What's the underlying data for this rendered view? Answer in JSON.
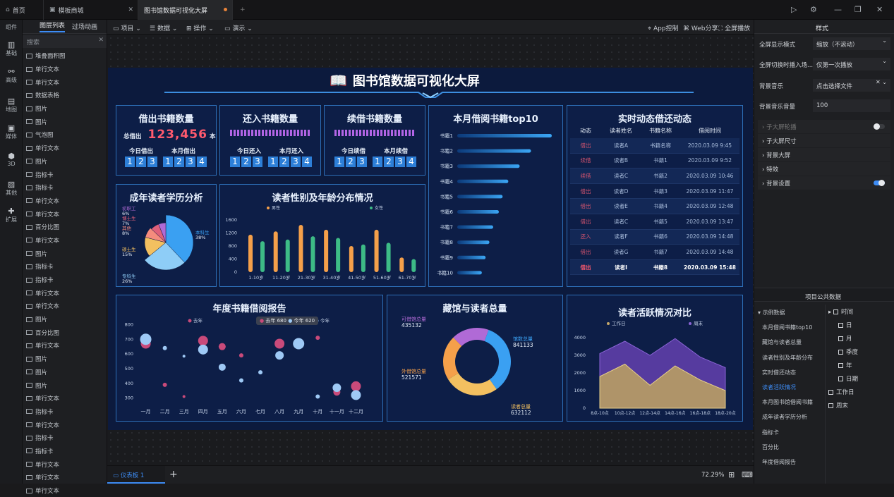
{
  "tabs": [
    {
      "label": "首页",
      "icon": "home-icon"
    },
    {
      "label": "模板商城",
      "icon": "store-icon"
    },
    {
      "label": "图书馆数据可视化大屏",
      "icon": ""
    }
  ],
  "left_nav": [
    {
      "label": "组件"
    },
    {
      "label": "基础"
    },
    {
      "label": "高级"
    },
    {
      "label": "地图"
    },
    {
      "label": "媒体"
    },
    {
      "label": "3D"
    },
    {
      "label": "其他"
    },
    {
      "label": "扩展"
    }
  ],
  "layers": {
    "tab_active": "图层列表",
    "tab_other": "过场动画",
    "search_placeholder": "搜索",
    "items": [
      "堆叠面积图",
      "单行文本",
      "单行文本",
      "数据表格",
      "图片",
      "图片",
      "气泡图",
      "单行文本",
      "图片",
      "指标卡",
      "指标卡",
      "单行文本",
      "单行文本",
      "百分比图",
      "单行文本",
      "图片",
      "指标卡",
      "指标卡",
      "单行文本",
      "单行文本",
      "图片",
      "百分比图",
      "单行文本",
      "图片",
      "图片",
      "图片",
      "单行文本",
      "指标卡",
      "单行文本",
      "指标卡",
      "指标卡",
      "单行文本",
      "单行文本",
      "单行文本"
    ]
  },
  "toolbar": {
    "project": "项目",
    "data": "数据",
    "operate": "操作",
    "demo": "演示",
    "app": "App控制",
    "web": "Web分享",
    "fullscreen": "全屏播放"
  },
  "status": {
    "board_tab": "仪表板 1",
    "add": "+",
    "zoom": "72.29%"
  },
  "right_panel": {
    "tab": "样式",
    "rows": [
      {
        "label": "全屏显示模式",
        "value": "缩放（不滚动）"
      },
      {
        "label": "全屏切换时播入场...",
        "value": "仅第一次播放"
      },
      {
        "label": "背景音乐",
        "value": "点击选择文件"
      },
      {
        "label": "背景音乐音量",
        "value": "100"
      }
    ],
    "sections": [
      "子大屏轮播",
      "子大屏尺寸",
      "背景大屏",
      "特效",
      "背景设置"
    ],
    "public_data_title": "项目公共数据",
    "public_data_list": [
      "示例数据",
      "本月借阅书籍top10",
      "藏馆与读者总量",
      "读者性别及年龄分布",
      "实时借还动态",
      "读者活跃情况",
      "本月图书馆借阅书籍",
      "成年读者学历分析",
      "指标卡",
      "百分比",
      "年度借阅报告"
    ],
    "fields": [
      "时间",
      "日",
      "月",
      "季度",
      "年",
      "日期",
      "工作日",
      "周末"
    ]
  },
  "dashboard": {
    "title": "图书馆数据可视化大屏",
    "borrow": {
      "title": "借出书籍数量",
      "total_label": "总借出",
      "total": "123,456",
      "unit": "本",
      "today_label": "今日借出",
      "today": [
        "1",
        "2",
        "3"
      ],
      "month_label": "本月借出",
      "month": [
        "1",
        "2",
        "3",
        "4"
      ]
    },
    "return": {
      "title": "还入书籍数量",
      "today_label": "今日还入",
      "today": [
        "1",
        "2",
        "3"
      ],
      "month_label": "本月还入",
      "month": [
        "1",
        "2",
        "3",
        "4"
      ]
    },
    "renew": {
      "title": "续借书籍数量",
      "today_label": "今日续借",
      "today": [
        "1",
        "2",
        "3"
      ],
      "month_label": "本月续借",
      "month": [
        "1",
        "2",
        "3",
        "4"
      ]
    },
    "top10": {
      "title": "本月借阅书籍top10"
    },
    "live": {
      "title": "实时动态借还动态",
      "headers": [
        "动态",
        "读者姓名",
        "书籍名称",
        "借阅时间"
      ],
      "rows": [
        [
          "借出",
          "读者A",
          "书籍名称",
          "2020.03.09 9:45"
        ],
        [
          "续借",
          "读者B",
          "书籍1",
          "2020.03.09 9:52"
        ],
        [
          "续借",
          "读者C",
          "书籍2",
          "2020.03.09 10:46"
        ],
        [
          "借出",
          "读者D",
          "书籍3",
          "2020.03.09 11:47"
        ],
        [
          "借出",
          "读者E",
          "书籍4",
          "2020.03.09 12:48"
        ],
        [
          "借出",
          "读者C",
          "书籍5",
          "2020.03.09 13:47"
        ],
        [
          "还入",
          "读者F",
          "书籍6",
          "2020.03.09 14:48"
        ],
        [
          "借出",
          "读者G",
          "书籍7",
          "2020.03.09 14:48"
        ],
        [
          "借出",
          "读者I",
          "书籍8",
          "2020.03.09 15:48"
        ]
      ]
    },
    "edu": {
      "title": "成年读者学历分析"
    },
    "gender": {
      "title": "读者性别及年龄分布情况"
    },
    "annual": {
      "title": "年度书籍借阅报告",
      "tooltip_prev": "去年",
      "tooltip_prev_val": "680",
      "tooltip_cur": "今年",
      "tooltip_cur_val": "620"
    },
    "collection": {
      "title": "藏馆与读者总量"
    },
    "active": {
      "title": "读者活跃情况对比"
    }
  },
  "chart_data": [
    {
      "type": "bar",
      "name": "top10",
      "categories": [
        "书籍1",
        "书籍2",
        "书籍3",
        "书籍4",
        "书籍5",
        "书籍6",
        "书籍7",
        "书籍8",
        "书籍9",
        "书籍10"
      ],
      "values": [
        100,
        78,
        66,
        54,
        48,
        44,
        38,
        34,
        30,
        26
      ]
    },
    {
      "type": "pie",
      "name": "edu",
      "labels": [
        "本科生",
        "专科生",
        "硕士生",
        "其他",
        "博士生",
        "初职工"
      ],
      "values": [
        38,
        26,
        15,
        8,
        7,
        6
      ],
      "colors": [
        "#3aa0f2",
        "#8ecdf7",
        "#f3c060",
        "#f58b7d",
        "#e0607a",
        "#b06ad6"
      ]
    },
    {
      "type": "bar",
      "name": "gender",
      "categories": [
        "1-10岁",
        "11-20岁",
        "21-30岁",
        "31-40岁",
        "41-50岁",
        "51-60岁",
        "61-70岁"
      ],
      "series": [
        {
          "name": "男性",
          "values": [
            1150,
            1250,
            1450,
            1300,
            800,
            1300,
            450
          ]
        },
        {
          "name": "女性",
          "values": [
            950,
            1000,
            1100,
            1050,
            850,
            900,
            400
          ]
        }
      ],
      "ylim": [
        0,
        1600
      ],
      "yticks": [
        0,
        400,
        800,
        1200,
        1600
      ]
    },
    {
      "type": "scatter",
      "name": "annual",
      "categories": [
        "一月",
        "二月",
        "三月",
        "四月",
        "五月",
        "六月",
        "七月",
        "八月",
        "九月",
        "十月",
        "十一月",
        "十二月"
      ],
      "series": [
        {
          "name": "去年",
          "values": [
            670,
            390,
            310,
            690,
            650,
            590,
            null,
            670,
            null,
            710,
            340,
            380
          ]
        },
        {
          "name": "今年",
          "values": [
            700,
            640,
            585,
            630,
            510,
            420,
            475,
            590,
            670,
            310,
            370,
            320
          ]
        }
      ],
      "ylim": [
        250,
        850
      ],
      "yticks": [
        300,
        400,
        500,
        600,
        700,
        800
      ]
    },
    {
      "type": "pie",
      "name": "collection",
      "labels": [
        "馆数总量",
        "读者总量",
        "外借馆总量",
        "可借馆总量"
      ],
      "values": [
        841133,
        632112,
        521571,
        435132
      ],
      "colors": [
        "#3aa0f2",
        "#f3c060",
        "#f5a04a",
        "#b06ad6"
      ]
    },
    {
      "type": "area",
      "name": "active",
      "categories": [
        "8点-10点",
        "10点-12点",
        "12点-14点",
        "14点-16点",
        "16点-18点",
        "18点-20点"
      ],
      "series": [
        {
          "name": "工作日",
          "values": [
            1800,
            2500,
            1300,
            2400,
            1600,
            1000
          ]
        },
        {
          "name": "周末",
          "values": [
            3100,
            3800,
            3000,
            3950,
            2900,
            2300
          ]
        }
      ],
      "ylim": [
        0,
        4000
      ],
      "yticks": [
        0,
        1000,
        2000,
        3000,
        4000
      ]
    }
  ],
  "colors": {
    "accent": "#3d8cf5",
    "panel_border": "#2d6fb8",
    "dash_bg": "#0c1a3d"
  }
}
